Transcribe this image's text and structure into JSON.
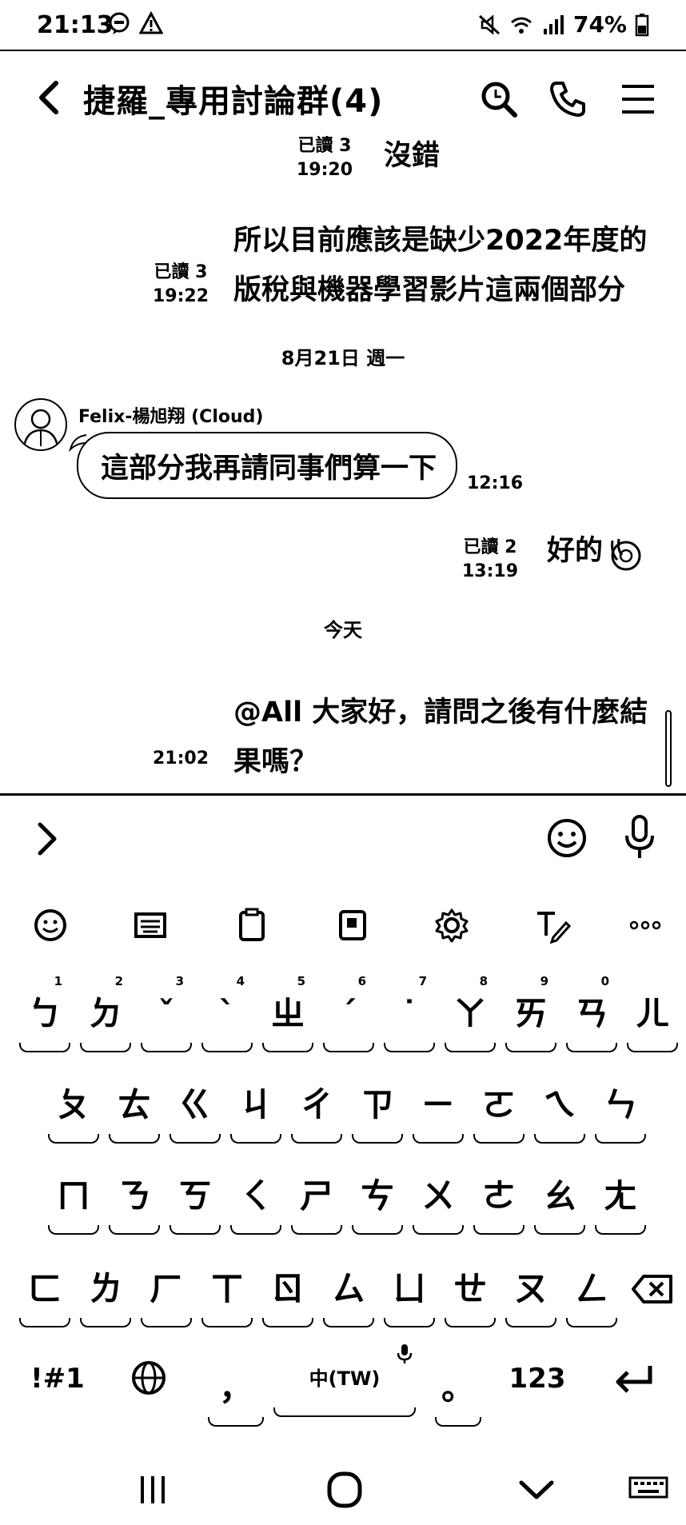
{
  "status_bar": {
    "time": "21:13",
    "battery": "74%",
    "left_icons": [
      "chat-bubble-icon",
      "warning-icon"
    ],
    "right_icons": [
      "mute-icon",
      "wifi-icon",
      "signal-icon",
      "battery-icon"
    ]
  },
  "header": {
    "title": "捷羅_專用討論群(4)"
  },
  "messages": [
    {
      "type": "out",
      "read": "已讀 3",
      "time": "19:20",
      "text": "沒錯"
    },
    {
      "type": "out",
      "read": "已讀 3",
      "time": "19:22",
      "line1": "所以目前應該是缺少2022年度的",
      "line2": "版稅與機器學習影片這兩個部分"
    },
    {
      "type": "date",
      "text": "8月21日 週一"
    },
    {
      "type": "in",
      "sender": "Felix-楊旭翔 (Cloud)",
      "text": "這部分我再請同事們算一下",
      "time": "12:16"
    },
    {
      "type": "out",
      "read": "已讀 2",
      "time": "13:19",
      "text": "好的"
    },
    {
      "type": "date",
      "text": "今天"
    },
    {
      "type": "out",
      "time": "21:02",
      "line1": "@All 大家好，請問之後有什麼結",
      "line2": "果嗎？"
    }
  ],
  "input": {
    "icons": [
      "chevron-right-icon",
      "emoji-icon",
      "mic-icon"
    ]
  },
  "keyboard": {
    "toolbar_icons": [
      "emoji-icon",
      "keyboard-icon",
      "clipboard-icon",
      "sticker-icon",
      "settings-icon",
      "handwriting-icon",
      "more-icon"
    ],
    "row1": [
      {
        "k": "ㄅ",
        "h": "1"
      },
      {
        "k": "ㄉ",
        "h": "2"
      },
      {
        "k": "ˇ",
        "h": "3"
      },
      {
        "k": "ˋ",
        "h": "4"
      },
      {
        "k": "ㄓ",
        "h": "5"
      },
      {
        "k": "ˊ",
        "h": "6"
      },
      {
        "k": "˙",
        "h": "7"
      },
      {
        "k": "ㄚ",
        "h": "8"
      },
      {
        "k": "ㄞ",
        "h": "9"
      },
      {
        "k": "ㄢ",
        "h": "0"
      },
      {
        "k": "ㄦ",
        "h": ""
      }
    ],
    "row2": [
      "ㄆ",
      "ㄊ",
      "ㄍ",
      "ㄐ",
      "ㄔ",
      "ㄗ",
      "ㄧ",
      "ㄛ",
      "ㄟ",
      "ㄣ"
    ],
    "row3": [
      "ㄇ",
      "ㄋ",
      "ㄎ",
      "ㄑ",
      "ㄕ",
      "ㄘ",
      "ㄨ",
      "ㄜ",
      "ㄠ",
      "ㄤ"
    ],
    "row4": [
      "ㄈ",
      "ㄌ",
      "ㄏ",
      "ㄒ",
      "ㄖ",
      "ㄙ",
      "ㄩ",
      "ㄝ",
      "ㄡ",
      "ㄥ"
    ],
    "bottom": {
      "symbols": "!#1",
      "comma": "，",
      "space": "中(TW)",
      "period": "。",
      "numbers": "123"
    }
  },
  "nav_bar": {
    "icons": [
      "recent-apps-icon",
      "home-icon",
      "back-chevron-icon",
      "keyboard-switch-icon"
    ]
  }
}
